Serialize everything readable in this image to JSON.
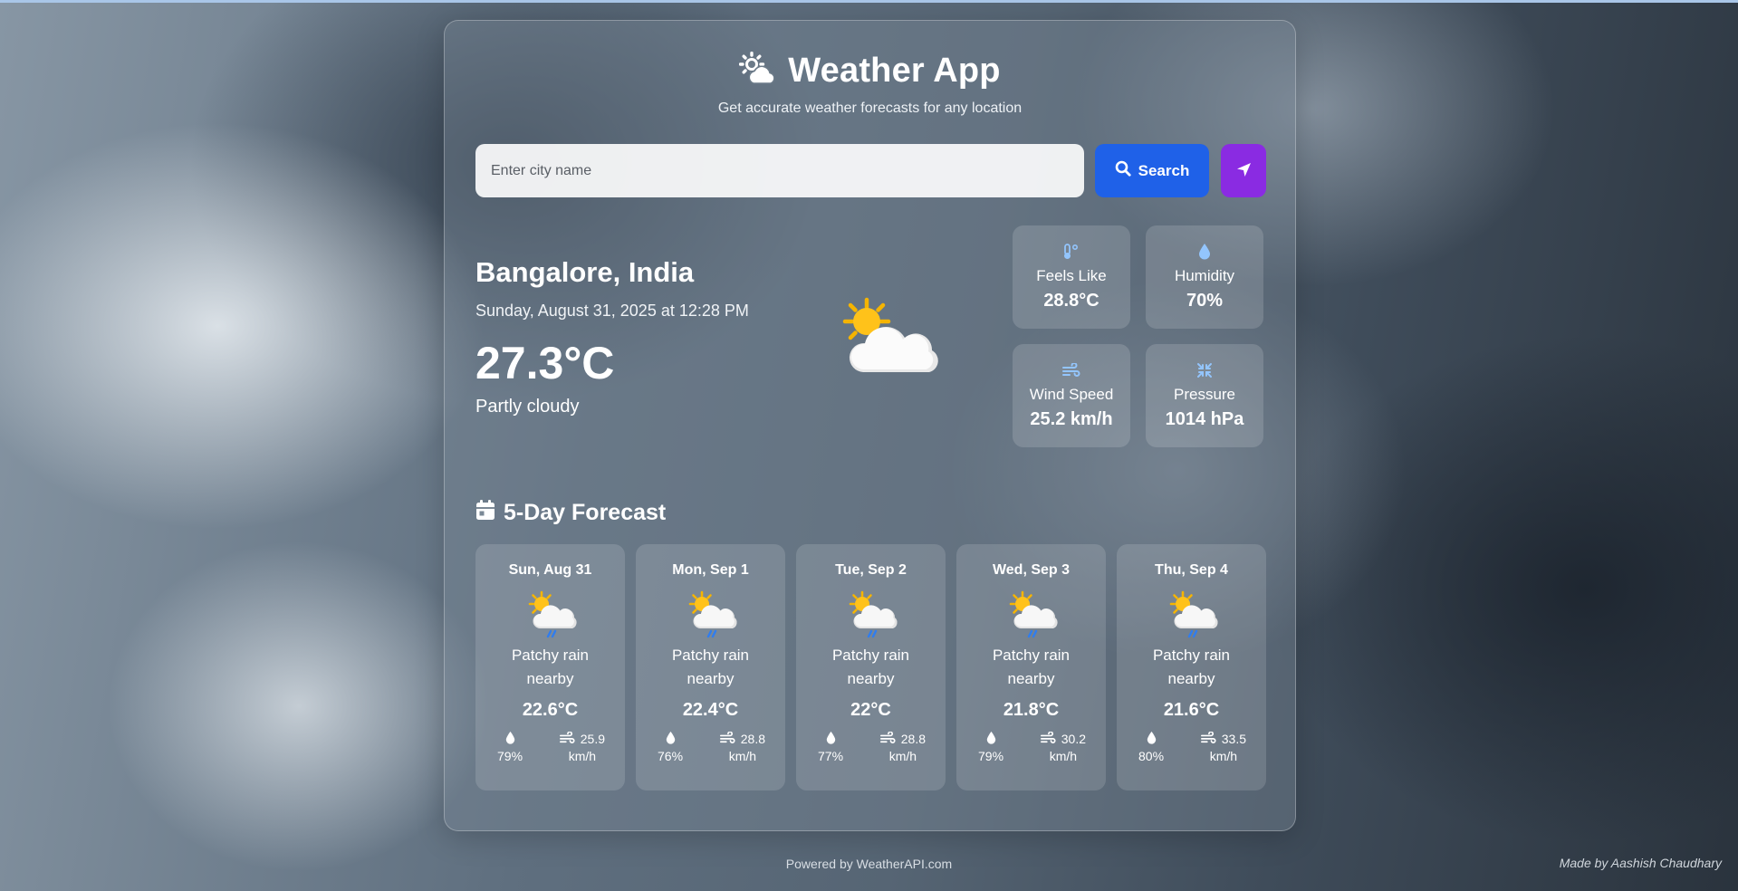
{
  "app": {
    "title": "Weather App",
    "subtitle": "Get accurate weather forecasts for any location",
    "icon": "sun-cloud-icon"
  },
  "search": {
    "placeholder": "Enter city name",
    "value": "",
    "button_label": "Search",
    "location_icon": "location-arrow-icon"
  },
  "current": {
    "location": "Bangalore, India",
    "datetime": "Sunday, August 31, 2025 at 12:28 PM",
    "temperature": "27.3°C",
    "condition": "Partly cloudy",
    "icon": "partly-cloudy-icon"
  },
  "stats": [
    {
      "label": "Feels Like",
      "value": "28.8°C",
      "icon": "thermometer-icon"
    },
    {
      "label": "Humidity",
      "value": "70%",
      "icon": "droplet-icon"
    },
    {
      "label": "Wind Speed",
      "value": "25.2 km/h",
      "icon": "wind-icon"
    },
    {
      "label": "Pressure",
      "value": "1014 hPa",
      "icon": "compress-icon"
    }
  ],
  "forecast": {
    "title": "5-Day Forecast",
    "days": [
      {
        "day": "Sun, Aug 31",
        "condition": "Patchy rain nearby",
        "temp": "22.6°C",
        "humidity": "79%",
        "wind": "25.9",
        "wind_unit": "km/h"
      },
      {
        "day": "Mon, Sep 1",
        "condition": "Patchy rain nearby",
        "temp": "22.4°C",
        "humidity": "76%",
        "wind": "28.8",
        "wind_unit": "km/h"
      },
      {
        "day": "Tue, Sep 2",
        "condition": "Patchy rain nearby",
        "temp": "22°C",
        "humidity": "77%",
        "wind": "28.8",
        "wind_unit": "km/h"
      },
      {
        "day": "Wed, Sep 3",
        "condition": "Patchy rain nearby",
        "temp": "21.8°C",
        "humidity": "79%",
        "wind": "30.2",
        "wind_unit": "km/h"
      },
      {
        "day": "Thu, Sep 4",
        "condition": "Patchy rain nearby",
        "temp": "21.6°C",
        "humidity": "80%",
        "wind": "33.5",
        "wind_unit": "km/h"
      }
    ]
  },
  "footer": {
    "powered": "Powered by WeatherAPI.com",
    "credit": "Made by Aashish Chaudhary"
  },
  "colors": {
    "search_button": "#1f61e8",
    "location_button": "#8a2be2",
    "stat_icon": "#93c5fd"
  }
}
